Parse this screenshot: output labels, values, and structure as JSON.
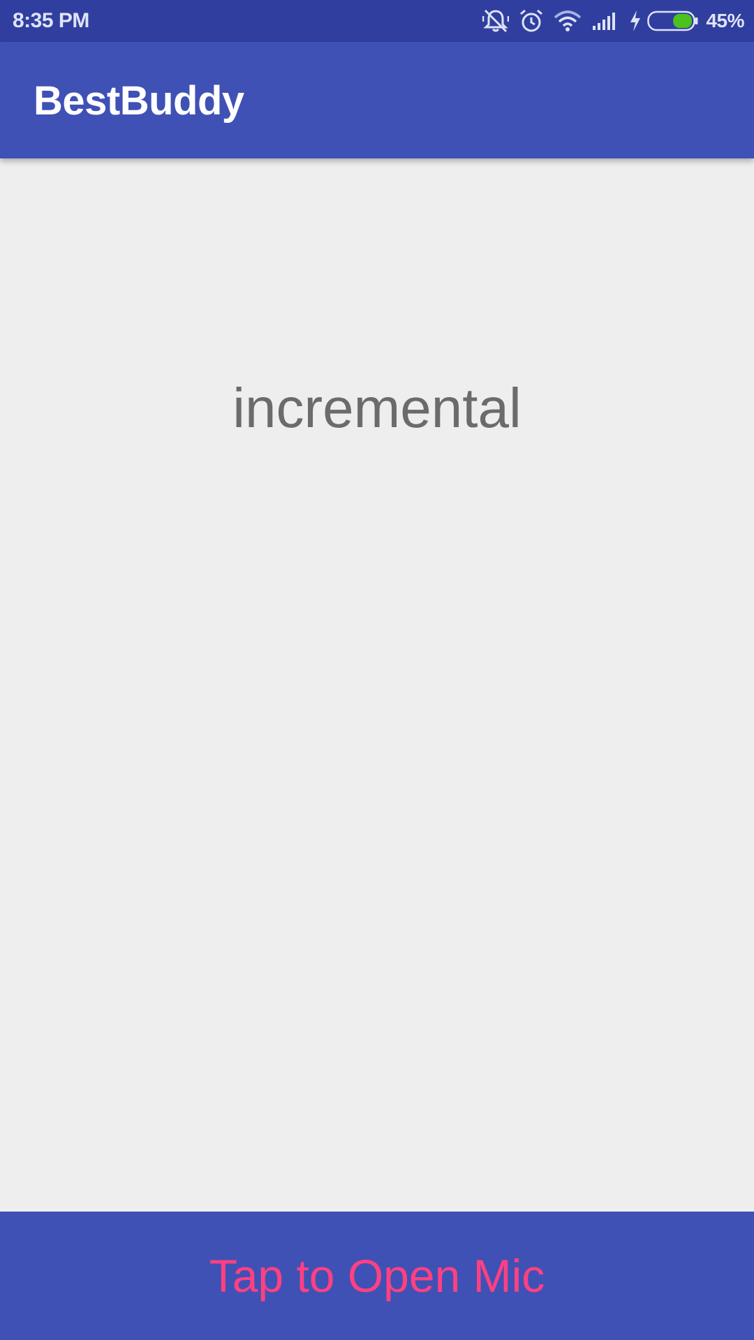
{
  "status_bar": {
    "time": "8:35 PM",
    "battery_percent": "45%",
    "battery_level": 0.45,
    "battery_fill_color": "#4CC21C",
    "icons": [
      "alarm-silenced-icon",
      "alarm-clock-icon",
      "wifi-icon",
      "signal-icon",
      "charging-icon",
      "battery-icon"
    ]
  },
  "toolbar": {
    "title": "BestBuddy",
    "background": "#3F51B5"
  },
  "main": {
    "recognized_text": "incremental"
  },
  "bottom_button": {
    "label": "Tap to Open Mic",
    "text_color": "#FF4081",
    "background": "#3F51B5"
  }
}
